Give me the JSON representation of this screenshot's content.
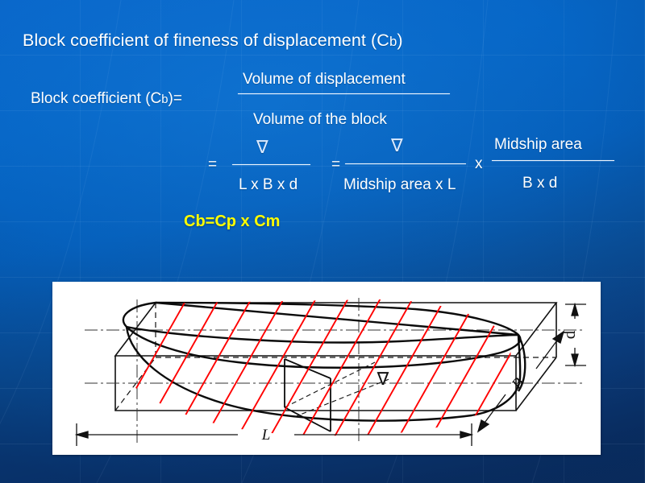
{
  "slide": {
    "background_color_top": "#0a6ace",
    "background_color_bottom": "#0e3468",
    "title_main": "Block coefficient of fineness of displacement (C",
    "title_sub": "b",
    "title_tail": ")"
  },
  "formula": {
    "lhs_main": "Block coefficient (C",
    "lhs_sub": "b",
    "lhs_tail": ")=",
    "row1": {
      "numerator": "Volume of displacement",
      "denominator": "Volume of the block"
    },
    "row2": {
      "eq1": "=",
      "frac1_numerator": "∇",
      "frac1_denominator": "L x B x d",
      "eq2": "=",
      "frac2_numerator": "∇",
      "frac2_denominator": "Midship area x L",
      "multiply": "x",
      "frac3_numerator": "Midship area",
      "frac3_denominator": "B x d"
    },
    "result": "Cb=Cp x Cm",
    "result_color": "#ffff00"
  },
  "figure": {
    "caption_length": "L",
    "caption_breadth": "B",
    "caption_draft": "d",
    "caption_volume": "∇",
    "hatch_color": "#ff0000",
    "line_color": "#000000",
    "panel_background": "#ffffff"
  }
}
